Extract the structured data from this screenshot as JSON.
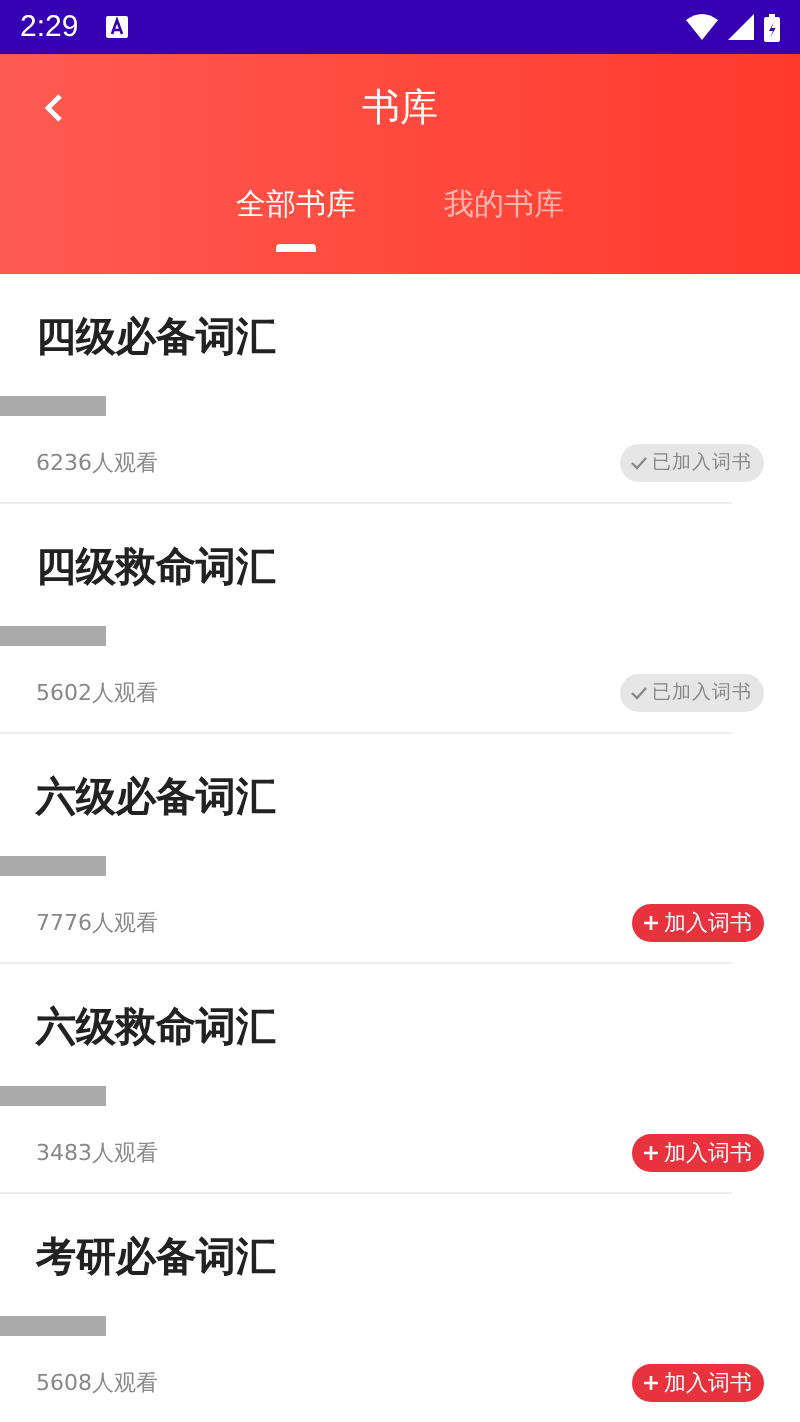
{
  "status_bar": {
    "time": "2:29"
  },
  "header": {
    "title": "书库"
  },
  "tabs": [
    {
      "label": "全部书库",
      "selected": true
    },
    {
      "label": "我的书库",
      "selected": false
    }
  ],
  "books": [
    {
      "title": "四级必备词汇",
      "views": "6236人观看",
      "added": true,
      "action": "已加入词书"
    },
    {
      "title": "四级救命词汇",
      "views": "5602人观看",
      "added": true,
      "action": "已加入词书"
    },
    {
      "title": "六级必备词汇",
      "views": "7776人观看",
      "added": false,
      "action": "加入词书"
    },
    {
      "title": "六级救命词汇",
      "views": "3483人观看",
      "added": false,
      "action": "加入词书"
    },
    {
      "title": "考研必备词汇",
      "views": "5608人观看",
      "added": false,
      "action": "加入词书"
    }
  ]
}
